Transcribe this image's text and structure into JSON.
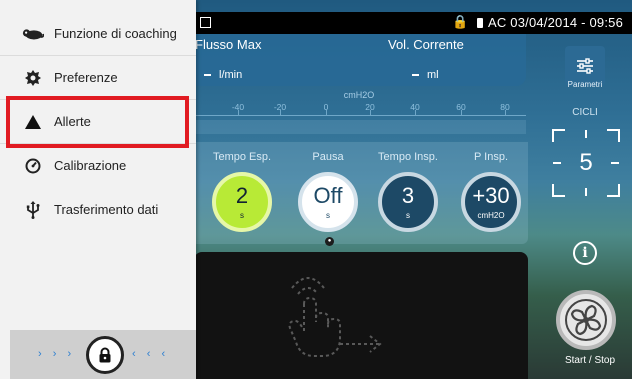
{
  "status_bar": {
    "ac_datetime": "AC  03/04/2014 - 09:56"
  },
  "flow": {
    "title": "Flusso Max",
    "unit": "l/min"
  },
  "volume": {
    "title": "Vol. Corrente",
    "unit": "ml"
  },
  "pressure_scale": {
    "unit": "cmH2O",
    "ticks": [
      "-40",
      "-20",
      "0",
      "20",
      "40",
      "60",
      "80"
    ]
  },
  "params": [
    {
      "label": "Tempo Esp.",
      "value": "2",
      "unit": "s"
    },
    {
      "label": "Pausa",
      "value": "Off",
      "unit": "s"
    },
    {
      "label": "Tempo Insp.",
      "value": "3",
      "unit": "s"
    },
    {
      "label": "P Insp.",
      "value": "+30",
      "unit": "cmH2O"
    }
  ],
  "right_panel": {
    "params_label": "Parametri",
    "cycles_label": "CICLI",
    "cycles_value": "5",
    "start_label": "Start / Stop"
  },
  "menu": {
    "items": [
      {
        "label": "Funzione di coaching",
        "icon": "chameleon-icon"
      },
      {
        "label": "Preferenze",
        "icon": "gear-icon"
      },
      {
        "label": "Allerte",
        "icon": "warning-triangle-icon"
      },
      {
        "label": "Calibrazione",
        "icon": "gauge-icon"
      },
      {
        "label": "Trasferimento dati",
        "icon": "usb-icon"
      }
    ],
    "highlight_color": "#e11b22",
    "selected_dial_color": "#b8ea36"
  },
  "drawer_bottom": {
    "left_chevrons": "› › ›",
    "right_chevrons": "‹ ‹ ‹"
  }
}
